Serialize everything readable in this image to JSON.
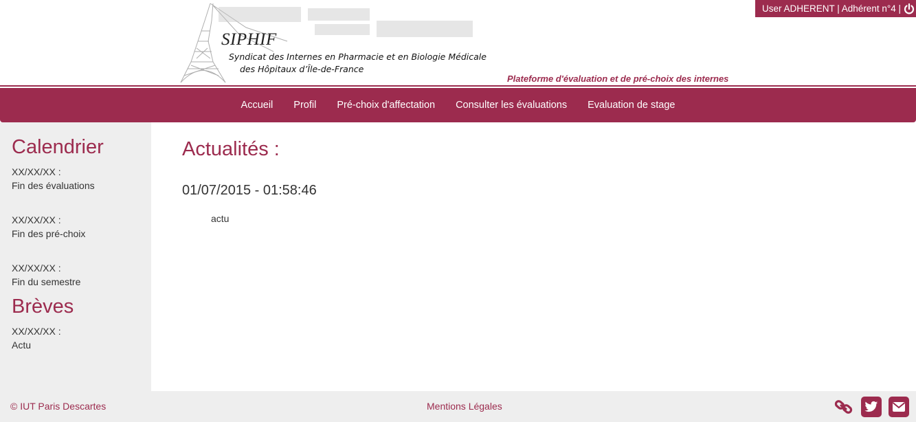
{
  "header": {
    "logo_title": "SIPHIF",
    "logo_subtitle_line1": "Syndicat des Internes en Pharmacie et en Biologie Médicale",
    "logo_subtitle_line2": "des Hôpitaux d’Île-de-France",
    "tagline": "Plateforme d'évaluation et de pré-choix des internes"
  },
  "user": {
    "label": "User ADHERENT | Adhérent n°4 |",
    "logout_icon": "power-icon"
  },
  "nav": {
    "items": [
      {
        "label": "Accueil"
      },
      {
        "label": "Profil"
      },
      {
        "label": "Pré-choix d'affectation"
      },
      {
        "label": "Consulter les évaluations"
      },
      {
        "label": "Evaluation de stage"
      }
    ]
  },
  "sidebar": {
    "calendar_title": "Calendrier",
    "calendar": [
      {
        "date": "XX/XX/XX :",
        "text": "Fin des évaluations"
      },
      {
        "date": "XX/XX/XX :",
        "text": "Fin des pré-choix"
      },
      {
        "date": "XX/XX/XX :",
        "text": "Fin du semestre"
      }
    ],
    "breves_title": "Brèves",
    "breves": [
      {
        "date": "XX/XX/XX :",
        "text": "Actu"
      }
    ]
  },
  "main": {
    "title": "Actualités :",
    "news": [
      {
        "date": "01/07/2015 - 01:58:46",
        "body": "actu"
      }
    ]
  },
  "footer": {
    "copyright": "© IUT Paris Descartes",
    "legal": "Mentions Légales",
    "icons": [
      "link-icon",
      "twitter-icon",
      "envelope-icon"
    ]
  },
  "colors": {
    "accent": "#9c2b4e",
    "panel": "#eeeeee"
  }
}
